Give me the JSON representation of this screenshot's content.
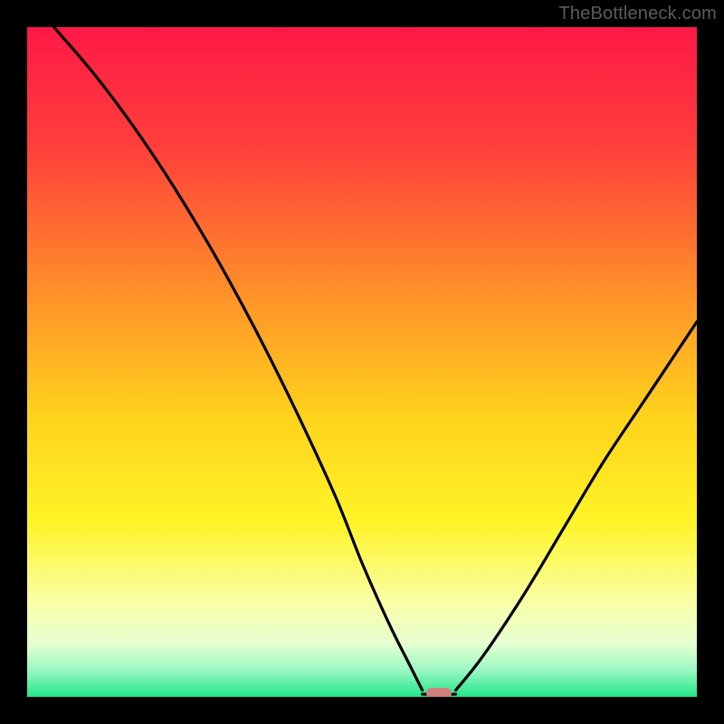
{
  "watermark": "TheBottleneck.com",
  "chart_data": {
    "type": "line",
    "title": "",
    "xlabel": "",
    "ylabel": "",
    "xlim": [
      0,
      100
    ],
    "ylim": [
      0,
      100
    ],
    "gradient_stops": [
      {
        "offset": 0,
        "color": "#ff1846"
      },
      {
        "offset": 18,
        "color": "#ff3f3b"
      },
      {
        "offset": 38,
        "color": "#ff8a2a"
      },
      {
        "offset": 58,
        "color": "#ffd21c"
      },
      {
        "offset": 74,
        "color": "#fff427"
      },
      {
        "offset": 86,
        "color": "#f9ffa8"
      },
      {
        "offset": 92,
        "color": "#e6ffd0"
      },
      {
        "offset": 96,
        "color": "#9cf7c4"
      },
      {
        "offset": 100,
        "color": "#20e68a"
      }
    ],
    "series": [
      {
        "name": "bottleneck-curve-left",
        "x": [
          4,
          10,
          16,
          22,
          28,
          34,
          40,
          46,
          50,
          54,
          57,
          59
        ],
        "y": [
          100,
          93,
          85,
          76,
          66,
          55,
          43,
          30,
          20,
          11,
          5,
          1
        ]
      },
      {
        "name": "bottleneck-curve-right",
        "x": [
          64,
          68,
          74,
          80,
          86,
          92,
          98,
          100
        ],
        "y": [
          1,
          6,
          15,
          25,
          35,
          44,
          53,
          56
        ]
      }
    ],
    "flat_segment": {
      "x0": 59,
      "x1": 64,
      "y": 0.4
    },
    "marker": {
      "x": 61.5,
      "y": 0.6,
      "color": "#d07f7f"
    }
  }
}
